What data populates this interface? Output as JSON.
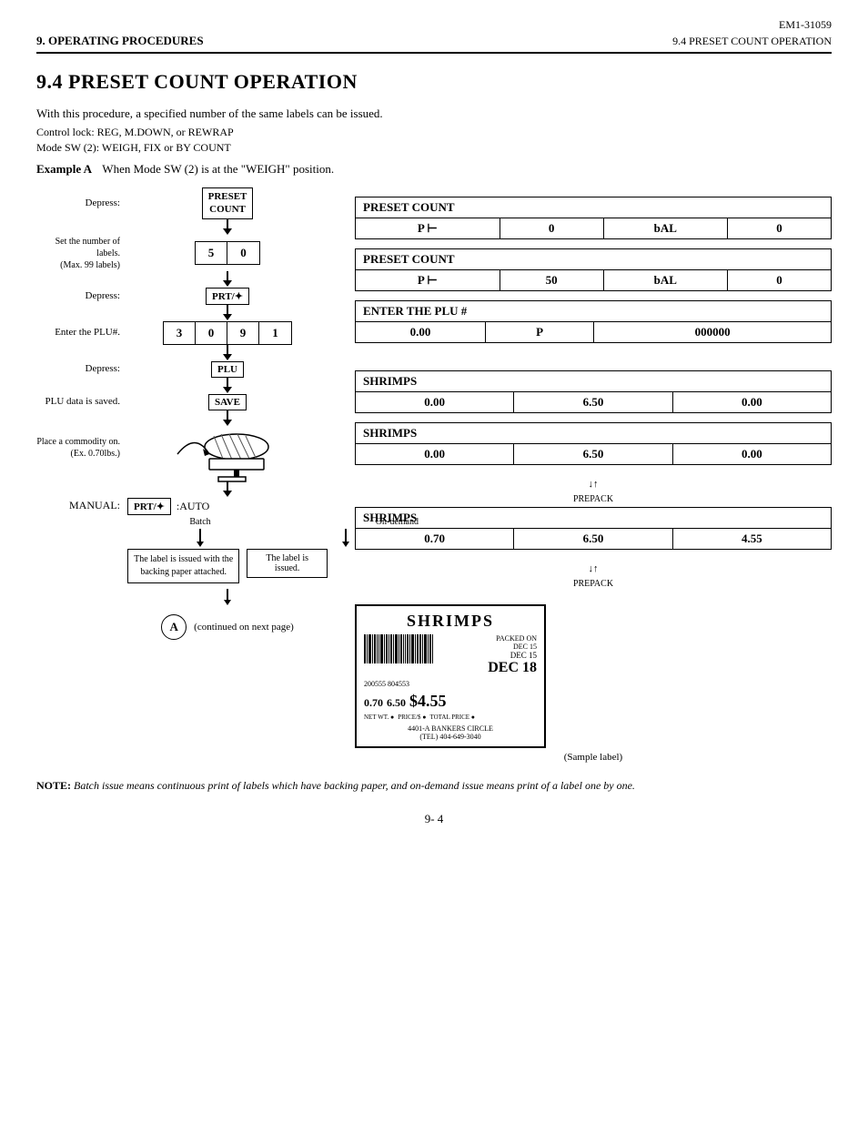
{
  "header": {
    "doc_number": "EM1-31059",
    "section_left": "9. OPERATING PROCEDURES",
    "section_right": "9.4  PRESET COUNT OPERATION"
  },
  "title": "9.4   PRESET COUNT OPERATION",
  "body_text": "With this procedure, a specified number of the same labels can be issued.",
  "control_lock": "Control lock:   REG, M.DOWN, or REWRAP",
  "mode_sw": "Mode SW (2):  WEIGH, FIX or BY COUNT",
  "example_a": {
    "label": "Example A",
    "desc": "When Mode SW (2) is at the \"WEIGH\" position."
  },
  "flowchart": {
    "step1_label": "Depress:",
    "step1_box": [
      "PRESET",
      "COUNT"
    ],
    "step2_label": "Set the number of labels.\n(Max. 99 labels)",
    "step2_cells": [
      "5",
      "0"
    ],
    "step3_label": "Depress:",
    "step3_box": "PRT/✦",
    "step4_label": "Enter the PLU#.",
    "step4_cells": [
      "3",
      "0",
      "9",
      "1"
    ],
    "step5_label": "Depress:",
    "step5_box": "PLU",
    "step6_label": "PLU data is saved.",
    "step6_box": "SAVE",
    "step7_label": "Place a commodity on.\n(Ex. 0.70lbs.)",
    "step8_manual": "MANUAL:",
    "step8_box": "PRT/✦",
    "step8_auto": ":AUTO",
    "step9_batch_label": "Batch",
    "step9_ondemand_label": "On-demand",
    "step9_batch_desc": "The label is issued with the\nbacking paper attached.",
    "step9_ondemand_desc": "The label is issued.",
    "circle_label": "A",
    "circle_note": "(continued on next page)"
  },
  "right_panels": {
    "panel1": {
      "header": "PRESET  COUNT",
      "cells": [
        "P ⊢",
        "0",
        "bAL",
        "0"
      ]
    },
    "panel2": {
      "header": "PRESET  COUNT",
      "cells": [
        "P ⊢",
        "50",
        "bAL",
        "0"
      ]
    },
    "panel3": {
      "header": "ENTER  THE  PLU #",
      "cells": [
        "0.00",
        "P",
        "000000"
      ]
    },
    "panel4": {
      "header": "SHRIMPS",
      "cells": [
        "0.00",
        "6.50",
        "0.00"
      ]
    },
    "panel5": {
      "header": "SHRIMPS",
      "cells": [
        "0.00",
        "6.50",
        "0.00"
      ]
    },
    "prepack1": "PREPACK",
    "panel6": {
      "header": "SHRIMPS",
      "cells": [
        "0.70",
        "6.50",
        "4.55"
      ]
    },
    "prepack2": "PREPACK"
  },
  "sample_label": {
    "title": "SHRIMPS",
    "packed_on": "PACKED ON",
    "selec_by_date": "DEC 15",
    "dec_date": "DEC 18",
    "net_wt": "0.70",
    "price_per": "6.50",
    "total": "$4.55",
    "net_label": "NET WT. ●",
    "price_label": "PRICE/$ ●",
    "total_label": "TOTAL  PRICE ●",
    "address": "4401-A BANKERS CIRCLE\n(TEL) 404-649-3040",
    "barcode": "200555 804553",
    "caption": "(Sample label)"
  },
  "note": {
    "bold": "NOTE:",
    "text": " Batch issue means continuous print of labels which have backing paper, and on-demand\n        issue means print of a label one by one."
  },
  "page_number": "9- 4"
}
